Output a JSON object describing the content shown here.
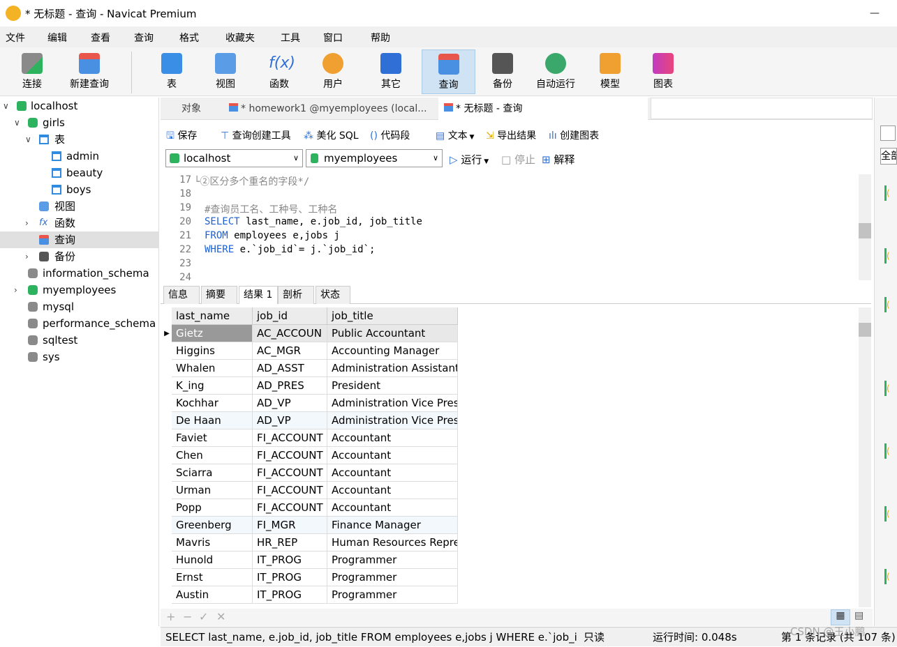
{
  "window": {
    "title": "* 无标题 - 查询 - Navicat Premium",
    "minimize": "—"
  },
  "menu": [
    "文件",
    "编辑",
    "查看",
    "查询",
    "格式",
    "收藏夹",
    "工具",
    "窗口",
    "帮助"
  ],
  "toolbar": {
    "connect": "连接",
    "new_query": "新建查询",
    "table": "表",
    "view": "视图",
    "function": "函数",
    "user": "用户",
    "other": "其它",
    "query": "查询",
    "backup": "备份",
    "automation": "自动运行",
    "model": "模型",
    "chart": "图表"
  },
  "tree": {
    "localhost": "localhost",
    "girls": "girls",
    "tables": "表",
    "admin": "admin",
    "beauty": "beauty",
    "boys": "boys",
    "views": "视图",
    "functions": "函数",
    "queries": "查询",
    "backups": "备份",
    "information_schema": "information_schema",
    "myemployees": "myemployees",
    "mysql": "mysql",
    "performance_schema": "performance_schema",
    "sqltest": "sqltest",
    "sys": "sys"
  },
  "tabs": {
    "objects": "对象",
    "homework": "* homework1 @myemployees (local...",
    "untitled": "* 无标题 - 查询"
  },
  "query_toolbar": {
    "save": "保存",
    "builder": "查询创建工具",
    "beautify": "美化 SQL",
    "snippet": "代码段",
    "text": "文本",
    "export": "导出结果",
    "create_chart": "创建图表"
  },
  "connection": {
    "server": "localhost",
    "database": "myemployees",
    "run": "运行",
    "stop": "停止",
    "explain": "解释"
  },
  "editor": {
    "lines": [
      {
        "n": "17",
        "text": "└②区分多个重名的字段*/"
      },
      {
        "n": "18",
        "text": ""
      },
      {
        "n": "19",
        "text": "#查询员工名、工种号、工种名"
      },
      {
        "n": "20",
        "kw": "SELECT",
        "text": " last_name, e.job_id, job_title"
      },
      {
        "n": "21",
        "kw": "FROM",
        "text": " employees e,jobs j"
      },
      {
        "n": "22",
        "kw": "WHERE",
        "text": " e.`job_id`= j.`job_id`;"
      },
      {
        "n": "23",
        "text": ""
      },
      {
        "n": "24",
        "text": ""
      }
    ]
  },
  "result_tabs": [
    "信息",
    "摘要",
    "结果 1",
    "剖析",
    "状态"
  ],
  "results": {
    "columns": [
      "last_name",
      "job_id",
      "job_title"
    ],
    "rows": [
      [
        "Gietz",
        "AC_ACCOUN",
        "Public Accountant"
      ],
      [
        "Higgins",
        "AC_MGR",
        "Accounting Manager"
      ],
      [
        "Whalen",
        "AD_ASST",
        "Administration Assistant"
      ],
      [
        "K_ing",
        "AD_PRES",
        "President"
      ],
      [
        "Kochhar",
        "AD_VP",
        "Administration Vice Pres"
      ],
      [
        "De Haan",
        "AD_VP",
        "Administration Vice Pres"
      ],
      [
        "Faviet",
        "FI_ACCOUNT",
        "Accountant"
      ],
      [
        "Chen",
        "FI_ACCOUNT",
        "Accountant"
      ],
      [
        "Sciarra",
        "FI_ACCOUNT",
        "Accountant"
      ],
      [
        "Urman",
        "FI_ACCOUNT",
        "Accountant"
      ],
      [
        "Popp",
        "FI_ACCOUNT",
        "Accountant"
      ],
      [
        "Greenberg",
        "FI_MGR",
        "Finance Manager"
      ],
      [
        "Mavris",
        "HR_REP",
        "Human Resources Repre"
      ],
      [
        "Hunold",
        "IT_PROG",
        "Programmer"
      ],
      [
        "Ernst",
        "IT_PROG",
        "Programmer"
      ],
      [
        "Austin",
        "IT_PROG",
        "Programmer"
      ]
    ]
  },
  "right_panel": {
    "all": "全部"
  },
  "status": {
    "sql": "SELECT last_name, e.job_id, job_title FROM employees e,jobs j WHERE e.`job_id`=",
    "readonly": "只读",
    "time": "运行时间: 0.048s",
    "records": "第 1 条记录 (共 107 条)"
  },
  "watermark": "CSDN @王小鹏"
}
